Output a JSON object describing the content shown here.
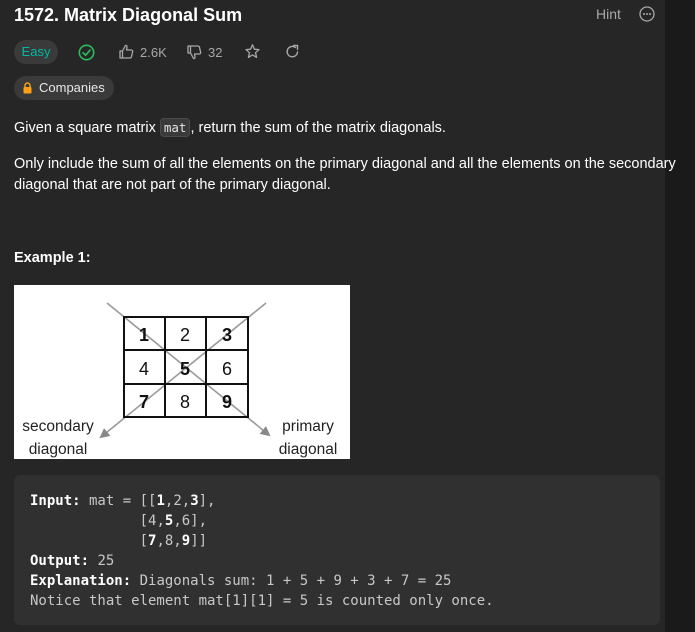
{
  "problem": {
    "title": "1572. Matrix Diagonal Sum",
    "hint_label": "Hint",
    "difficulty": "Easy",
    "likes": "2.6K",
    "dislikes": "32",
    "companies_label": "Companies"
  },
  "description": {
    "p1_before": "Given a square matrix ",
    "p1_code": "mat",
    "p1_after": ", return the sum of the matrix diagonals.",
    "p2_line1": "Only include the sum of all the elements on the primary diagonal and all the elements on the secondary",
    "p2_line2": "diagonal that are not part of the primary diagonal."
  },
  "example1": {
    "title": "Example 1:",
    "figure": {
      "cells": [
        "1",
        "2",
        "3",
        "4",
        "5",
        "6",
        "7",
        "8",
        "9"
      ],
      "secondary_label_line1": "secondary",
      "secondary_label_line2": "diagonal",
      "primary_label_line1": "primary",
      "primary_label_line2": "diagonal"
    },
    "input_label": "Input:",
    "input_var": " mat = ",
    "input_rows": [
      {
        "open": "[[",
        "a": "1",
        "m": ",2,",
        "b": "3",
        "close": "],"
      },
      {
        "open": "[",
        "a": "4,",
        "m": "5",
        "b": ",6",
        "close": "],"
      },
      {
        "open": "[",
        "a": "7",
        "m": ",8,",
        "b": "9",
        "close": "]]"
      }
    ],
    "output_label": "Output:",
    "output_value": " 25",
    "explanation_label": "Explanation:",
    "explanation_value": " Diagonals sum: 1 + 5 + 9 + 3 + 7 = 25",
    "notice": "Notice that element mat[1][1] = 5 is counted only once."
  },
  "colors": {
    "background": "#262626",
    "easy": "#00b8a3",
    "check": "#2cbb5d",
    "text": "#ffffff",
    "muted": "#a8a8a8"
  },
  "icons": [
    "more-icon",
    "check-circle-icon",
    "thumbs-up-icon",
    "thumbs-down-icon",
    "star-icon",
    "share-icon",
    "lock-icon"
  ]
}
